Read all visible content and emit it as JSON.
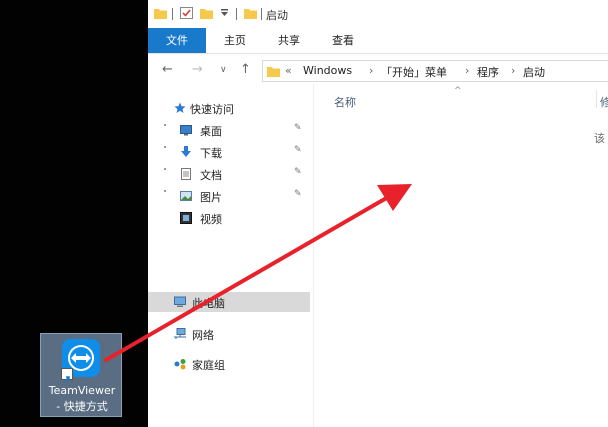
{
  "desktop": {
    "shortcut": {
      "line1": "TeamViewer",
      "line2": "- 快捷方式"
    }
  },
  "window": {
    "title": "启动",
    "ribbon_tabs": [
      "文件",
      "主页",
      "共享",
      "查看"
    ],
    "nav": {
      "back": "←",
      "forward": "→",
      "dropdown": "∨",
      "up": "↑"
    },
    "address": {
      "overflow": "«",
      "crumbs": [
        "Windows",
        "「开始」菜单",
        "程序",
        "启动"
      ],
      "separator": "›"
    },
    "sidebar": {
      "quick_access": "快速访问",
      "quick_items": [
        "桌面",
        "下载",
        "文档",
        "图片",
        "视频"
      ],
      "pin": "✎",
      "this_pc": "此电脑",
      "network": "网络",
      "homegroup": "家庭组"
    },
    "content": {
      "column_name": "名称",
      "sort_indicator": "^",
      "column_more": "修",
      "empty_hint": "该"
    }
  },
  "colors": {
    "file_tab": "#1979ca",
    "annotation_arrow": "#e8212a",
    "teamviewer_blue": "#0e8ee9"
  },
  "icons": {
    "qa": [
      "folder-icon",
      "properties-check-icon",
      "new-folder-icon",
      "customize-dropdown-icon"
    ],
    "sidebar": [
      "star-icon",
      "desktop-icon",
      "download-icon",
      "documents-icon",
      "pictures-icon",
      "videos-icon",
      "computer-icon",
      "network-icon",
      "homegroup-icon"
    ]
  }
}
